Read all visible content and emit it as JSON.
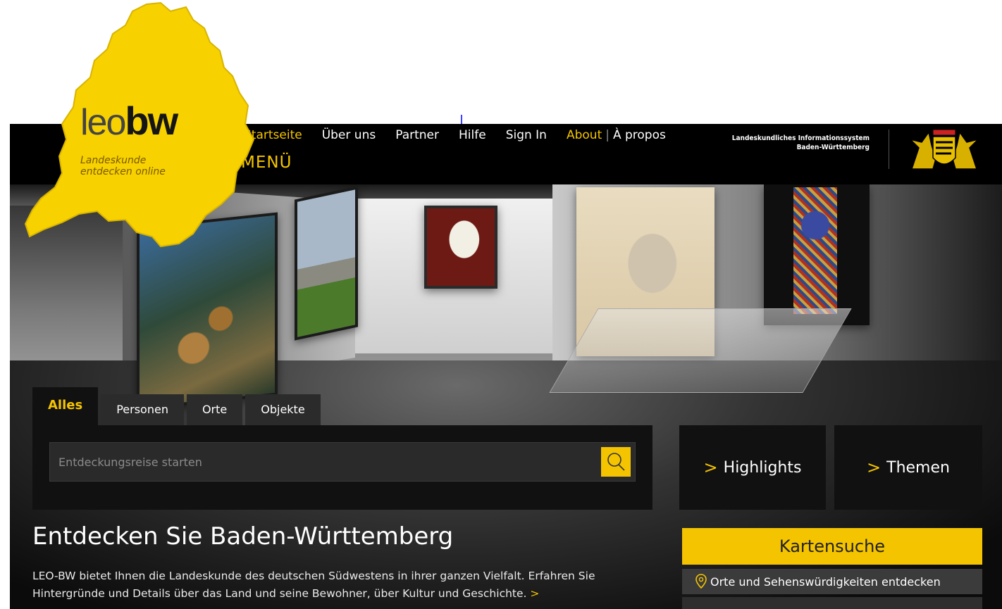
{
  "logo": {
    "leo": "leo",
    "bw": "bw",
    "subtitle_line1": "Landeskunde",
    "subtitle_line2": "entdecken online"
  },
  "nav": {
    "items": [
      {
        "label": "Startseite"
      },
      {
        "label": "Über uns"
      },
      {
        "label": "Partner"
      },
      {
        "label": "Hilfe"
      },
      {
        "label": "Sign In"
      }
    ],
    "about": "About",
    "separator": "|",
    "apropos": "À propos",
    "menu": "MENÜ"
  },
  "header": {
    "info_line1": "Landeskundliches Informationssystem",
    "info_line2": "Baden-Württemberg",
    "coat_of_arms": "coat-of-arms-icon"
  },
  "search": {
    "tabs": [
      {
        "label": "Alles",
        "active": true
      },
      {
        "label": "Personen"
      },
      {
        "label": "Orte"
      },
      {
        "label": "Objekte"
      }
    ],
    "placeholder": "Entdeckungsreise starten",
    "button_icon": "search-icon"
  },
  "tiles": {
    "highlights": "Highlights",
    "themen": "Themen",
    "chevron": ">"
  },
  "intro": {
    "title": "Entdecken Sie Baden-Württemberg",
    "text": "LEO-BW bietet Ihnen die Landeskunde des deutschen Südwestens in ihrer ganzen Vielfalt. Erfahren Sie Hintergründe und Details über das Land und seine Bewohner, über Kultur und Geschichte.",
    "more": ">"
  },
  "map_search": {
    "title": "Kartensuche",
    "link": "Orte und Sehenswürdigkeiten entdecken",
    "link_icon": "map-pin-icon"
  },
  "colors": {
    "accent": "#f5c400",
    "bar": "#000000",
    "panel": "#111111"
  }
}
